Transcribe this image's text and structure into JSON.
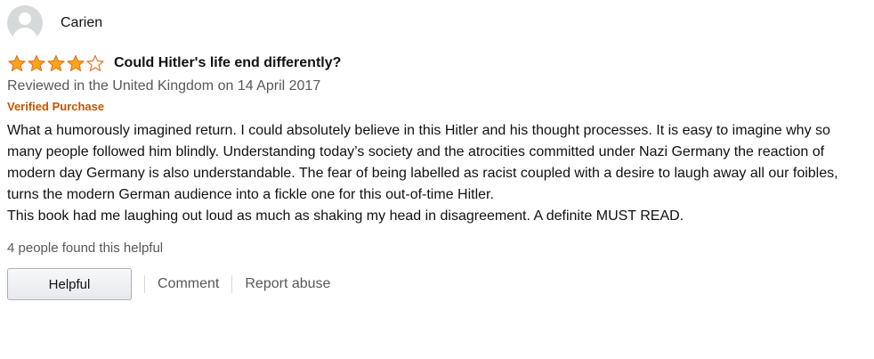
{
  "reviewer": {
    "name": "Carien"
  },
  "rating": {
    "value": 4,
    "max": 5,
    "star_color": "#ffa41c",
    "star_outline_color": "#de7921"
  },
  "review": {
    "title": "Could Hitler's life end differently?",
    "date": "Reviewed in the United Kingdom on 14 April 2017",
    "verified_label": "Verified Purchase",
    "body": [
      "What a humorously imagined return. I could absolutely believe in this Hitler and his thought processes. It is easy to imagine why so many people followed him blindly. Understanding today’s society and the atrocities committed under Nazi Germany the reaction of modern day Germany is also understandable. The fear of being labelled as racist coupled with a desire to laugh away all our foibles, turns the modern German audience into a fickle one for this out-of-time Hitler.",
      "This book had me laughing out loud as much as shaking my head in disagreement. A definite MUST READ."
    ]
  },
  "helpful": {
    "count_text": "4 people found this helpful",
    "button_label": "Helpful"
  },
  "actions": {
    "comment_label": "Comment",
    "report_label": "Report abuse"
  }
}
